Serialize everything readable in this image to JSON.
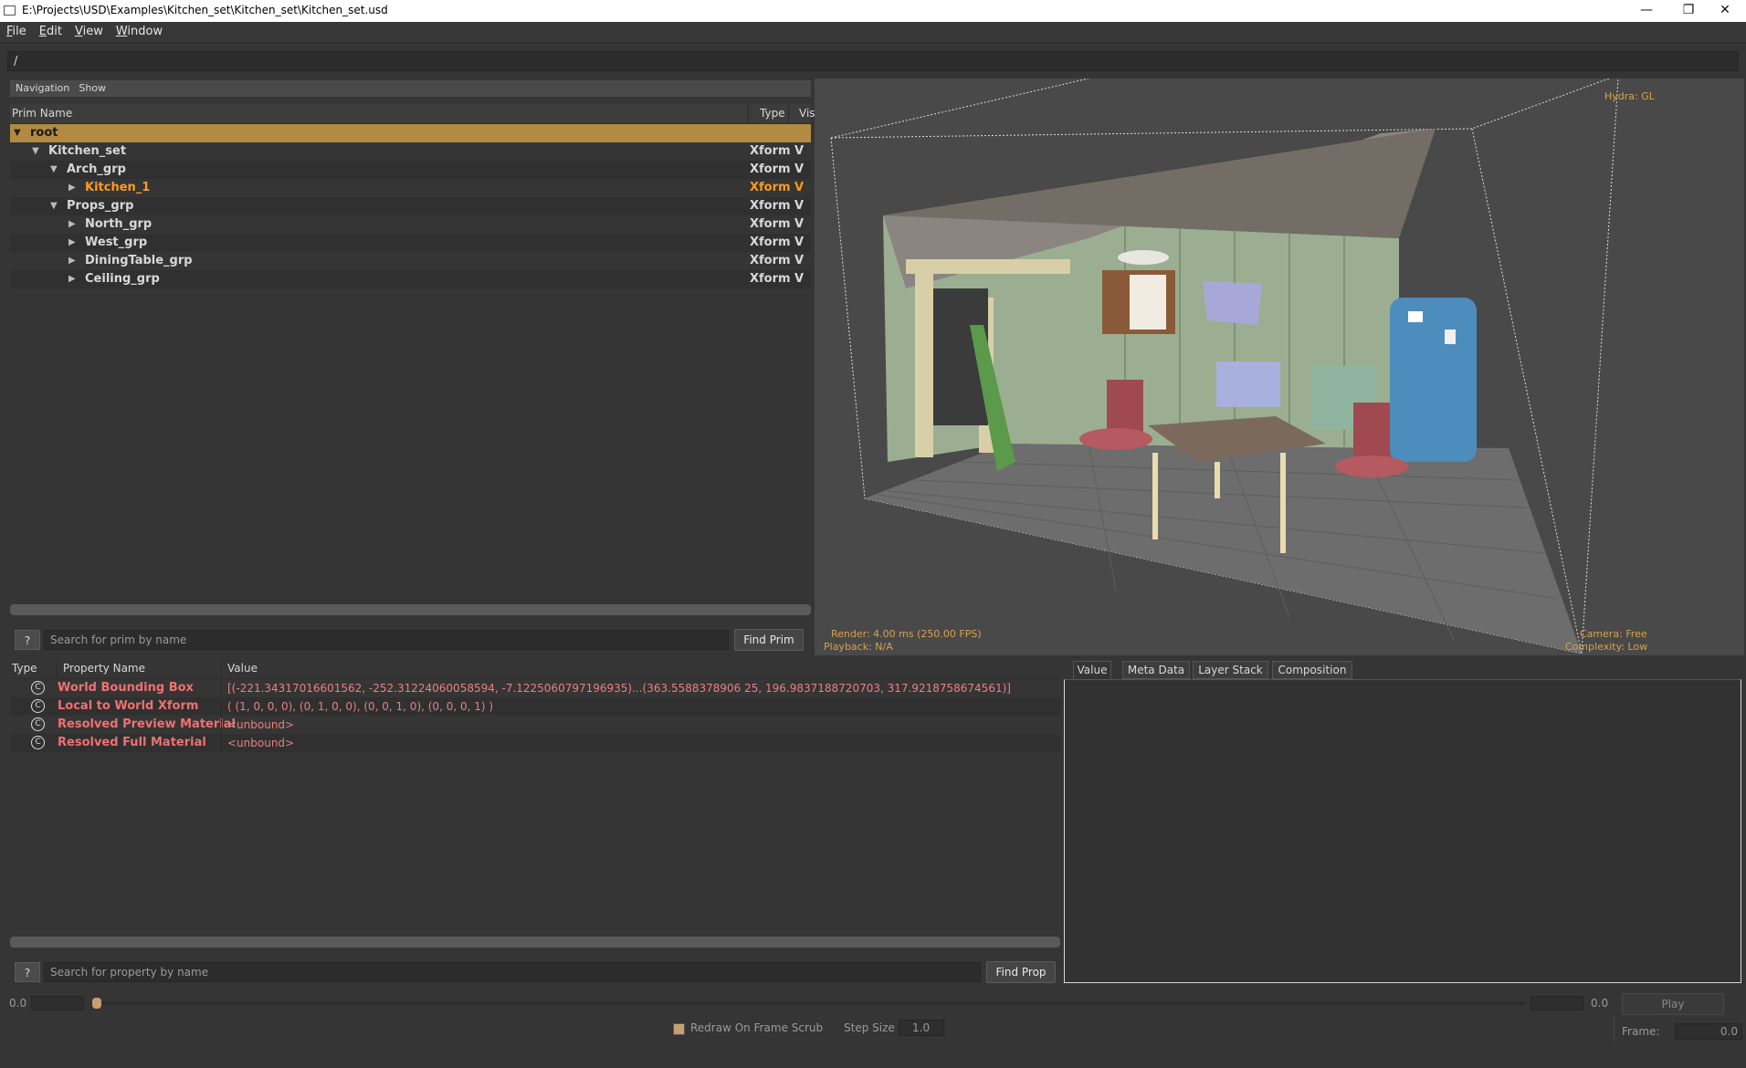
{
  "window": {
    "title": "E:\\Projects\\USD\\Examples\\Kitchen_set\\Kitchen_set\\Kitchen_set.usd",
    "minimize": "—",
    "restore": "❐",
    "close": "✕"
  },
  "menu": [
    "File",
    "Edit",
    "View",
    "Window"
  ],
  "path": "/",
  "prim_panel": {
    "nav_items": [
      "Navigation",
      "Show"
    ],
    "columns": {
      "name": "Prim Name",
      "type": "Type",
      "vis": "Vis"
    },
    "rows": [
      {
        "name": "root",
        "type": "",
        "vis": "",
        "depth": 0,
        "expanded": true,
        "selected": true
      },
      {
        "name": "Kitchen_set",
        "type": "Xform",
        "vis": "V",
        "depth": 1,
        "expanded": true
      },
      {
        "name": "Arch_grp",
        "type": "Xform",
        "vis": "V",
        "depth": 2,
        "expanded": true
      },
      {
        "name": "Kitchen_1",
        "type": "Xform",
        "vis": "V",
        "depth": 3,
        "expanded": false,
        "highlight": true
      },
      {
        "name": "Props_grp",
        "type": "Xform",
        "vis": "V",
        "depth": 2,
        "expanded": true
      },
      {
        "name": "North_grp",
        "type": "Xform",
        "vis": "V",
        "depth": 3,
        "expanded": false
      },
      {
        "name": "West_grp",
        "type": "Xform",
        "vis": "V",
        "depth": 3,
        "expanded": false
      },
      {
        "name": "DiningTable_grp",
        "type": "Xform",
        "vis": "V",
        "depth": 3,
        "expanded": false
      },
      {
        "name": "Ceiling_grp",
        "type": "Xform",
        "vis": "V",
        "depth": 3,
        "expanded": false
      }
    ],
    "help_label": "?",
    "search_placeholder": "Search for prim by name",
    "find_label": "Find Prim"
  },
  "viewport": {
    "renderer": "Hydra: GL",
    "render_stats": "Render: 4.00 ms (250.00 FPS)",
    "playback": "Playback: N/A",
    "camera": "Camera: Free",
    "complexity": "Complexity: Low"
  },
  "property_panel": {
    "columns": {
      "type": "Type",
      "name": "Property Name",
      "value": "Value"
    },
    "rows": [
      {
        "icon": "C",
        "name": "World Bounding Box",
        "value": "[(-221.34317016601562, -252.31224060058594, -7.1225060797196935)...(363.5588378906 25, 196.9837188720703, 317.9218758674561)]"
      },
      {
        "icon": "C",
        "name": "Local to World Xform",
        "value": "( (1, 0, 0, 0), (0, 1, 0, 0), (0, 0, 1, 0), (0, 0, 0, 1) )"
      },
      {
        "icon": "C",
        "name": "Resolved Preview Material",
        "value": "<unbound>"
      },
      {
        "icon": "C",
        "name": "Resolved Full Material",
        "value": "<unbound>"
      }
    ],
    "help_label": "?",
    "search_placeholder": "Search for property by name",
    "find_label": "Find Prop"
  },
  "right_panel": {
    "tabs": [
      "Value",
      "Meta Data",
      "Layer Stack",
      "Composition"
    ],
    "active_tab": "Value"
  },
  "timeline": {
    "start": "0.0",
    "end": "0.0",
    "play_label": "Play",
    "redraw_label": "Redraw On Frame Scrub",
    "step_size_label": "Step Size",
    "step_size_value": "1.0",
    "frame_label": "Frame:",
    "frame_value": "0.0"
  },
  "colors": {
    "selected_row": "#b38a42",
    "highlight_text": "#ff9a1e",
    "computed_prop": "#f07070",
    "hud": "#d8a24a"
  }
}
